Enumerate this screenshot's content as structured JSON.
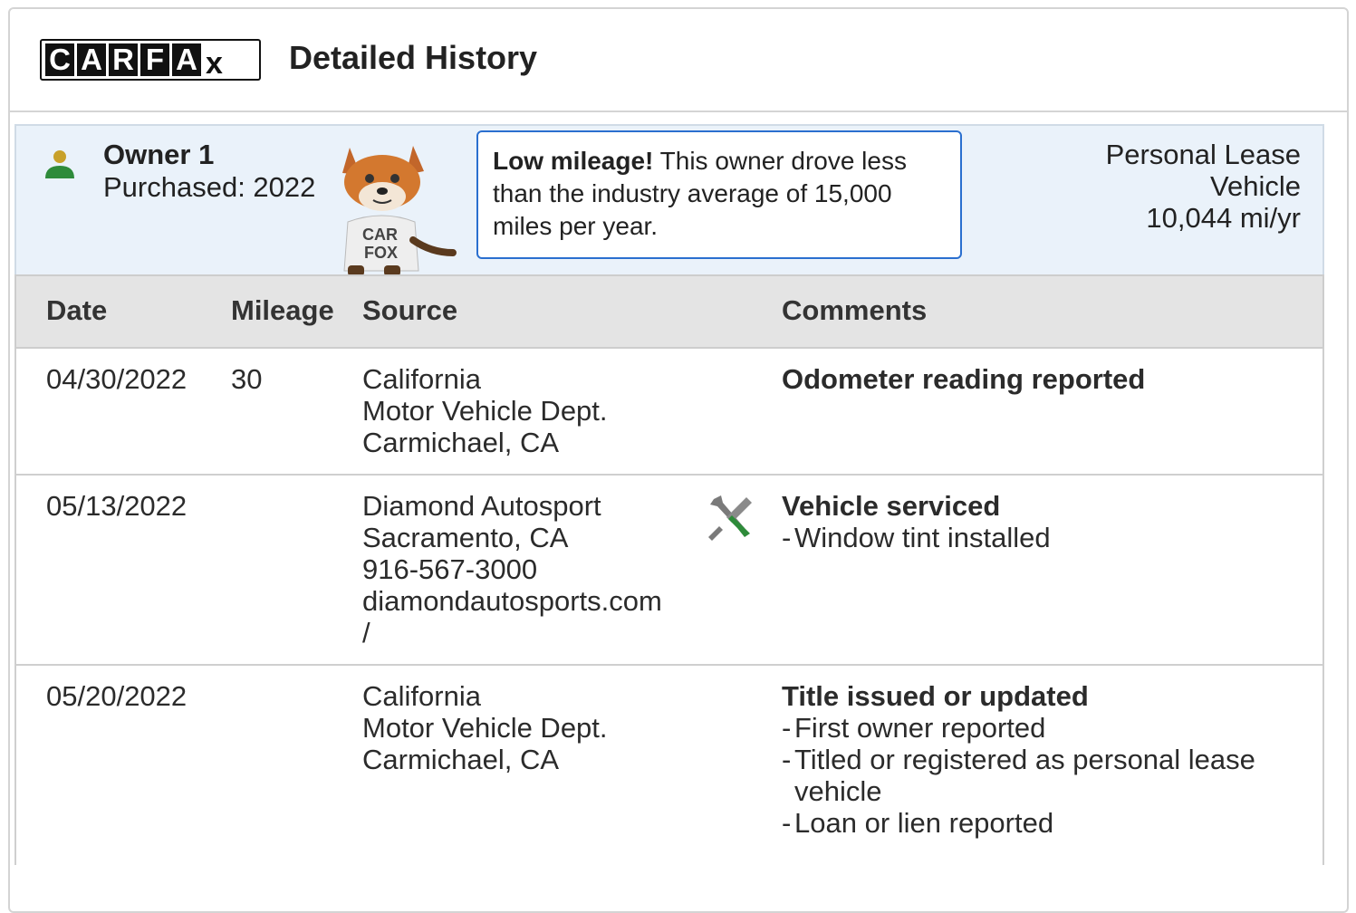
{
  "header": {
    "logo_letters": [
      "C",
      "A",
      "R",
      "F",
      "A"
    ],
    "logo_x": "x",
    "title": "Detailed History"
  },
  "owner": {
    "name": "Owner 1",
    "purchased": "Purchased: 2022",
    "mascot": "carfox-mascot-icon",
    "callout_bold": "Low mileage!",
    "callout_text": " This owner drove less than the industry average of 15,000 miles per year.",
    "lease_line1": "Personal Lease",
    "lease_line2": "Vehicle",
    "mileage_per_year": "10,044 mi/yr"
  },
  "table": {
    "headers": {
      "date": "Date",
      "mileage": "Mileage",
      "source": "Source",
      "comments": "Comments"
    },
    "rows": [
      {
        "date": "04/30/2022",
        "mileage": "30",
        "source": [
          "California",
          "Motor Vehicle Dept.",
          "Carmichael, CA"
        ],
        "comment_title": "Odometer reading reported",
        "comment_items": []
      },
      {
        "date": "05/13/2022",
        "mileage": "",
        "source": [
          "Diamond Autosport",
          "Sacramento, CA",
          "916-567-3000",
          "diamondautosports.com",
          "/"
        ],
        "icon": "tools-icon",
        "comment_title": "Vehicle serviced",
        "comment_items": [
          "Window tint installed"
        ]
      },
      {
        "date": "05/20/2022",
        "mileage": "",
        "source": [
          "California",
          "Motor Vehicle Dept.",
          "Carmichael, CA"
        ],
        "comment_title": "Title issued or updated",
        "comment_items": [
          "First owner reported",
          "Titled or registered as personal lease vehicle",
          "Loan or lien reported"
        ]
      }
    ]
  },
  "colors": {
    "accent_blue": "#2a6fcf",
    "panel_bg": "#eaf2fa",
    "header_bg": "#e4e4e4",
    "person_head": "#c8a12a",
    "person_body": "#2e8b3a"
  }
}
